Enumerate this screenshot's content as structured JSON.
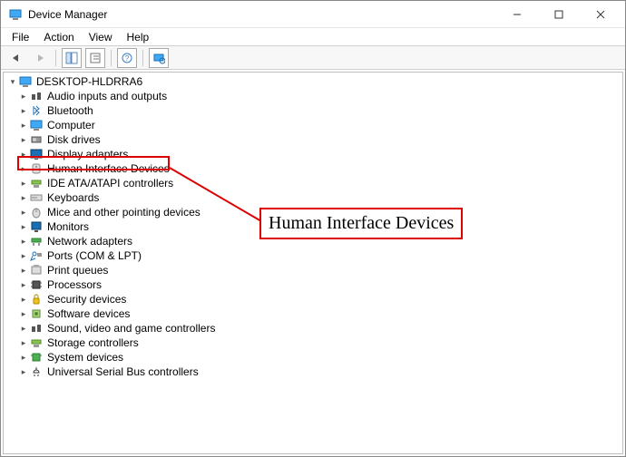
{
  "title": "Device Manager",
  "menu": {
    "file": "File",
    "action": "Action",
    "view": "View",
    "help": "Help"
  },
  "root": "DESKTOP-HLDRRA6",
  "categories": [
    "Audio inputs and outputs",
    "Bluetooth",
    "Computer",
    "Disk drives",
    "Display adapters",
    "Human Interface Devices",
    "IDE ATA/ATAPI controllers",
    "Keyboards",
    "Mice and other pointing devices",
    "Monitors",
    "Network adapters",
    "Ports (COM & LPT)",
    "Print queues",
    "Processors",
    "Security devices",
    "Software devices",
    "Sound, video and game controllers",
    "Storage controllers",
    "System devices",
    "Universal Serial Bus controllers"
  ],
  "callout": "Human Interface Devices"
}
